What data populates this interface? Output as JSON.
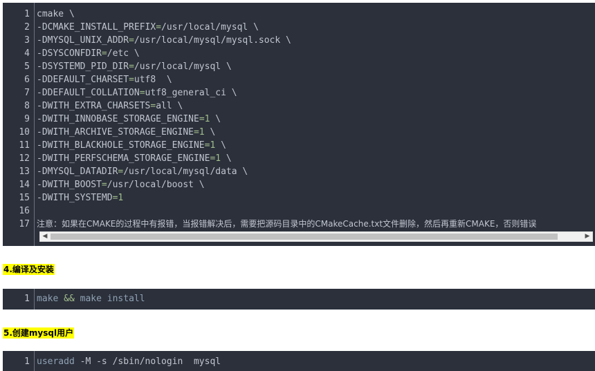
{
  "block1": {
    "line_numbers": [
      "1",
      "2",
      "3",
      "4",
      "5",
      "6",
      "7",
      "8",
      "9",
      "10",
      "11",
      "12",
      "13",
      "14",
      "15",
      "16",
      "17"
    ],
    "lines": [
      {
        "pre": "cmake \\"
      },
      {
        "pre": "-DCMAKE_INSTALL_PREFIX",
        "eq": "=",
        "post": "/usr/local/mysql \\"
      },
      {
        "pre": "-DMYSQL_UNIX_ADDR",
        "eq": "=",
        "post": "/usr/local/mysql/mysql.sock \\"
      },
      {
        "pre": "-DSYSCONFDIR",
        "eq": "=",
        "post": "/etc \\"
      },
      {
        "pre": "-DSYSTEMD_PID_DIR",
        "eq": "=",
        "post": "/usr/local/mysql \\"
      },
      {
        "pre": "-DDEFAULT_CHARSET",
        "eq": "=",
        "post": "utf8  \\"
      },
      {
        "pre": "-DDEFAULT_COLLATION",
        "eq": "=",
        "post": "utf8_general_ci \\"
      },
      {
        "pre": "-DWITH_EXTRA_CHARSETS",
        "eq": "=",
        "post": "all \\"
      },
      {
        "pre": "-DWITH_INNOBASE_STORAGE_ENGINE",
        "eq": "=1",
        "post": " \\"
      },
      {
        "pre": "-DWITH_ARCHIVE_STORAGE_ENGINE",
        "eq": "=1",
        "post": " \\"
      },
      {
        "pre": "-DWITH_BLACKHOLE_STORAGE_ENGINE",
        "eq": "=1",
        "post": " \\"
      },
      {
        "pre": "-DWITH_PERFSCHEMA_STORAGE_ENGINE",
        "eq": "=1",
        "post": " \\"
      },
      {
        "pre": "-DMYSQL_DATADIR",
        "eq": "=",
        "post": "/usr/local/mysql/data \\"
      },
      {
        "pre": "-DWITH_BOOST",
        "eq": "=",
        "post": "/usr/local/boost \\"
      },
      {
        "pre": "-DWITH_SYSTEMD",
        "eq": "=1",
        "post": ""
      },
      {
        "pre": ""
      },
      {
        "pre": "注意：如果在CMAKE的过程中有报错，当报错解决后，需要把源码目录中的CMakeCache.txt文件删除，然后再重新CMAKE，否则错误"
      }
    ]
  },
  "heading1": "4.编译及安装",
  "block2": {
    "line_number": "1",
    "cmd1": "make",
    "op": "&&",
    "cmd2": "make install"
  },
  "heading2": "5.创建mysql用户",
  "block3": {
    "line_number": "1",
    "cmd": "useradd",
    "args": " -M -s /sbin/nologin  mysql"
  },
  "colors": {
    "code_bg": "#2b303b",
    "text": "#c0c5ce",
    "green": "#a3be8c",
    "blue": "#8fa1b3",
    "highlight": "#ffff00"
  }
}
